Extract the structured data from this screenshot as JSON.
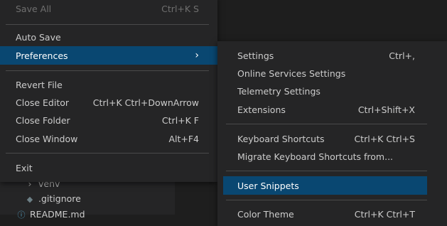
{
  "background": {
    "explorer_items": [
      {
        "label": "venv",
        "icon": "chevron-right-icon"
      },
      {
        "label": ".gitignore",
        "icon": "git-file-icon"
      },
      {
        "label": "README.md",
        "icon": "info-file-icon"
      }
    ]
  },
  "menu": {
    "items": [
      {
        "label": "Save All",
        "shortcut": "Ctrl+K S",
        "disabled": true
      },
      {
        "label": "Auto Save",
        "shortcut": ""
      },
      {
        "label": "Preferences",
        "shortcut": "",
        "submenu_indicator": "chevron-right-icon",
        "active": true
      },
      {
        "label": "Revert File",
        "shortcut": ""
      },
      {
        "label": "Close Editor",
        "shortcut": "Ctrl+K Ctrl+DownArrow"
      },
      {
        "label": "Close Folder",
        "shortcut": "Ctrl+K F"
      },
      {
        "label": "Close Window",
        "shortcut": "Alt+F4"
      },
      {
        "label": "Exit",
        "shortcut": ""
      }
    ]
  },
  "submenu": {
    "items": [
      {
        "label": "Settings",
        "shortcut": "Ctrl+,"
      },
      {
        "label": "Online Services Settings",
        "shortcut": ""
      },
      {
        "label": "Telemetry Settings",
        "shortcut": ""
      },
      {
        "label": "Extensions",
        "shortcut": "Ctrl+Shift+X"
      },
      {
        "label": "Keyboard Shortcuts",
        "shortcut": "Ctrl+K Ctrl+S"
      },
      {
        "label": "Migrate Keyboard Shortcuts from...",
        "shortcut": ""
      },
      {
        "label": "User Snippets",
        "shortcut": "",
        "highlighted": true
      },
      {
        "label": "Color Theme",
        "shortcut": "Ctrl+K Ctrl+T"
      }
    ]
  },
  "colors": {
    "menu_bg": "#252526",
    "highlight_bg": "#094771",
    "text": "#cccccc",
    "disabled_text": "#6f6f6f"
  }
}
